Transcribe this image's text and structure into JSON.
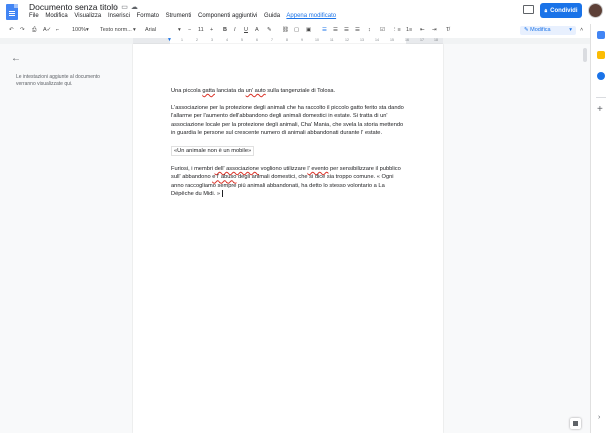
{
  "header": {
    "title": "Documento senza titolo",
    "share_label": "Condividi"
  },
  "menu": {
    "items": [
      "File",
      "Modifica",
      "Visualizza",
      "Inserisci",
      "Formato",
      "Strumenti",
      "Componenti aggiuntivi",
      "Guida"
    ],
    "last_edit": "Appena modificato"
  },
  "toolbar": {
    "zoom": "100%",
    "style": "Testo norm...",
    "font": "Arial",
    "font_size": "11",
    "mode_label": "Modifica"
  },
  "ruler": {
    "numbers": [
      "1",
      "2",
      "3",
      "4",
      "5",
      "6",
      "7",
      "8",
      "9",
      "10",
      "11",
      "12",
      "13",
      "14",
      "15",
      "16",
      "17",
      "18"
    ]
  },
  "outline": {
    "empty_text": "Le intestazioni aggiunte al documento verranno visualizzate qui."
  },
  "document": {
    "p1": {
      "a": "Una piccola ",
      "b": "gatta",
      "c": " lanciata da ",
      "d": "un' auto",
      "e": " sulla tangenziale di Tolosa."
    },
    "p2": {
      "a": "L'associazione per la protezione degli animali che ha raccolto il piccolo gatto ferito sta dando l'allarme per l'aumento dell'abbandono degli animali domestici in estate. Si tratta di un' associazione locale per la protezione degli animali, Cha' Mania, che svela la storia mettendo in guardia le persone sul crescente numero di animali abbandonati durante l' estate."
    },
    "p3": "«Un animale non è un mobile»",
    "p4": {
      "a": "Furiosi, i membri ",
      "b": "dell' associazione",
      "c": " vogliono utilizzare ",
      "d": "l' evento",
      "e": " per sensibilizzare il pubblico sull' abbandono ",
      "f": "e l' abuso",
      "g": " degli animali domestici, che si dice sia troppo comune. « Ogni anno raccogliamo sempre più animali abbandonati, ha detto lo stesso volontario a La Dépêche du Midi. »"
    }
  },
  "colors": {
    "accent": "#1a73e8",
    "doc_blue": "#4285f4",
    "keep_yellow": "#fbbc04",
    "tasks_blue": "#1a73e8",
    "calendar_blue": "#4285f4"
  }
}
